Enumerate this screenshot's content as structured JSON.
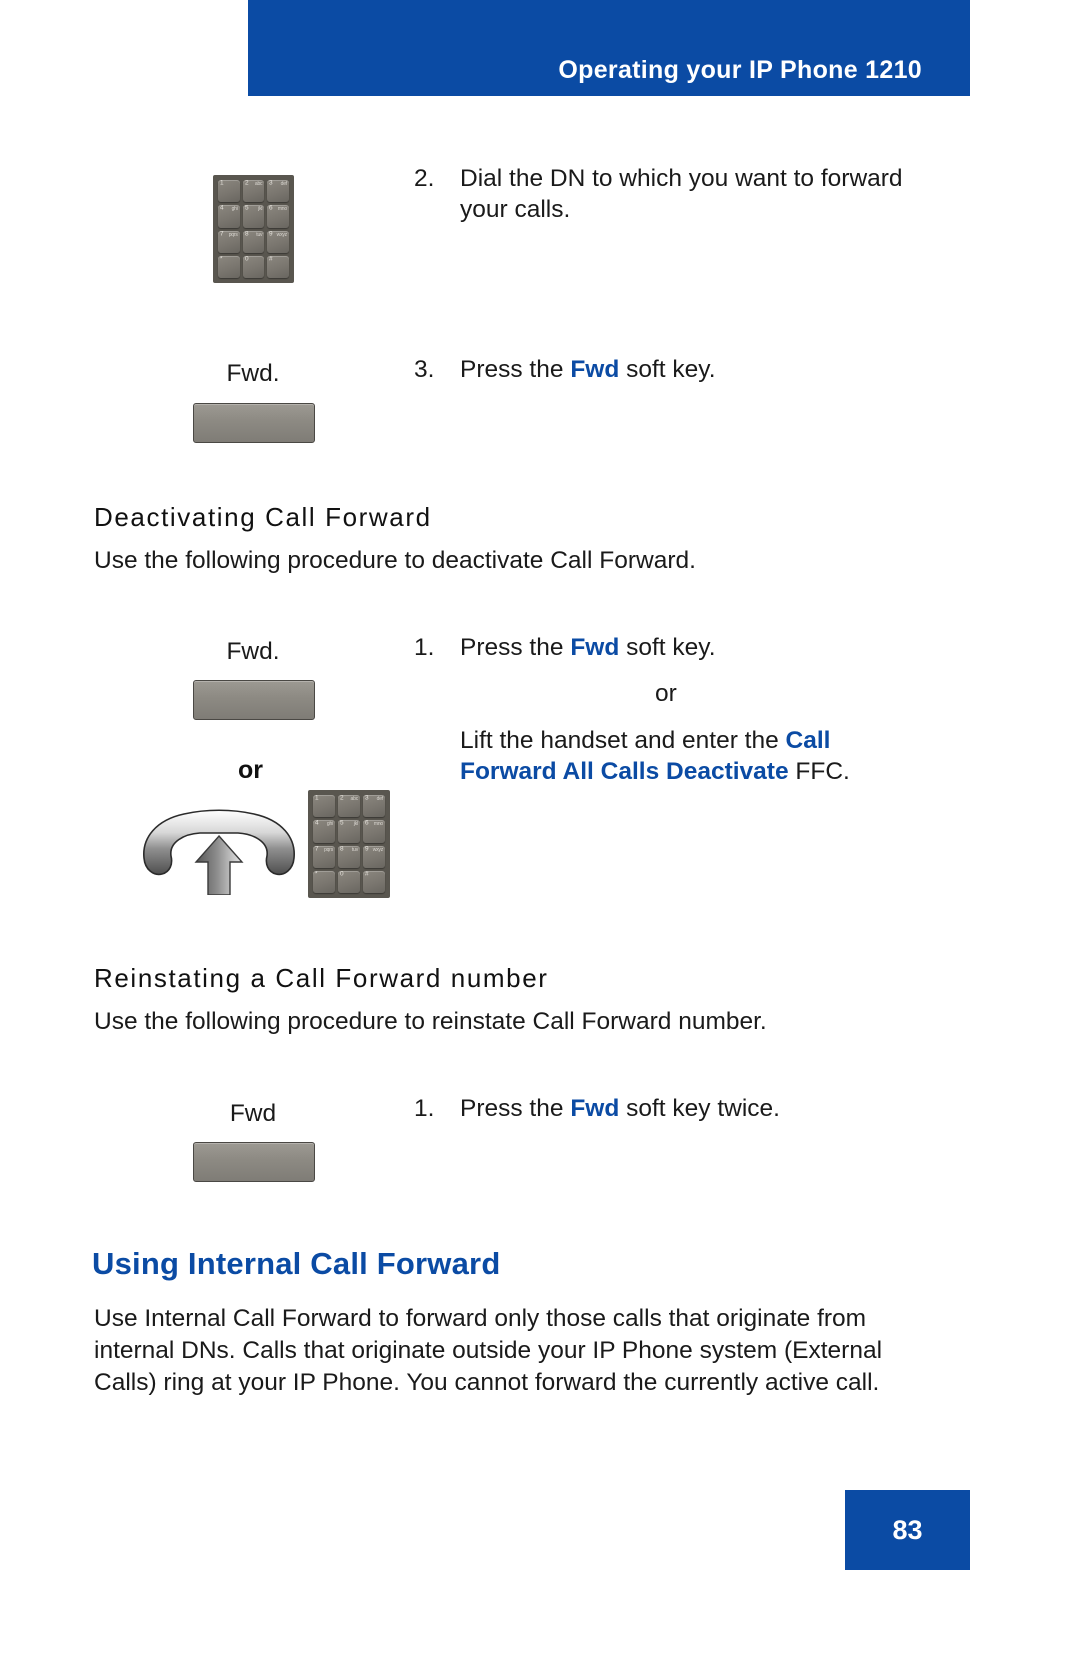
{
  "header": {
    "title": "Operating your IP Phone 1210",
    "banner_color": "#0b4ba4"
  },
  "colors": {
    "accent_blue": "#0b4ba4",
    "softkey_gray": "#8e8b84",
    "keypad_body": "#59564f"
  },
  "keypad": {
    "keys": [
      {
        "digit": "1",
        "letters": ""
      },
      {
        "digit": "2",
        "letters": "abc"
      },
      {
        "digit": "3",
        "letters": "def"
      },
      {
        "digit": "4",
        "letters": "ghi"
      },
      {
        "digit": "5",
        "letters": "jkl"
      },
      {
        "digit": "6",
        "letters": "mno"
      },
      {
        "digit": "7",
        "letters": "pqrs"
      },
      {
        "digit": "8",
        "letters": "tuv"
      },
      {
        "digit": "9",
        "letters": "wxyz"
      },
      {
        "digit": "*",
        "letters": ""
      },
      {
        "digit": "0",
        "letters": ""
      },
      {
        "digit": "#",
        "letters": ""
      }
    ]
  },
  "step_dial": {
    "number": "2.",
    "line1": "Dial the DN to which you want to forward",
    "line2": "your calls."
  },
  "step_press_fwd": {
    "number": "3.",
    "prefix": "Press the ",
    "keyword": "Fwd",
    "suffix": " soft key."
  },
  "softkey_fwd_1": {
    "label": "Fwd."
  },
  "section_deactivating": {
    "heading": "Deactivating Call Forward",
    "intro": "Use the following procedure to deactivate Call Forward.",
    "softkey_label": "Fwd.",
    "or_left": "or",
    "step": {
      "number": "1.",
      "prefix": "Press the ",
      "keyword": "Fwd",
      "suffix": " soft key."
    },
    "or_mid": "or",
    "alt_line1_prefix": "Lift the handset and enter the ",
    "alt_line1_keyword": "Call",
    "alt_line2_keyword": "Forward All Calls Deactivate",
    "alt_line2_suffix": " FFC."
  },
  "section_reinstating": {
    "heading": "Reinstating a Call Forward number",
    "intro": "Use the following procedure to reinstate Call Forward number.",
    "softkey_label": "Fwd",
    "step": {
      "number": "1.",
      "prefix": "Press the ",
      "keyword": "Fwd",
      "suffix": " soft key twice."
    }
  },
  "section_internal": {
    "heading": "Using Internal Call Forward",
    "paragraph_line1": "Use Internal Call Forward to forward only those calls that originate from",
    "paragraph_line2": "internal DNs. Calls that originate outside your IP Phone system (External",
    "paragraph_line3": "Calls) ring at your IP Phone. You cannot forward the currently active call."
  },
  "footer": {
    "page_number": "83"
  }
}
